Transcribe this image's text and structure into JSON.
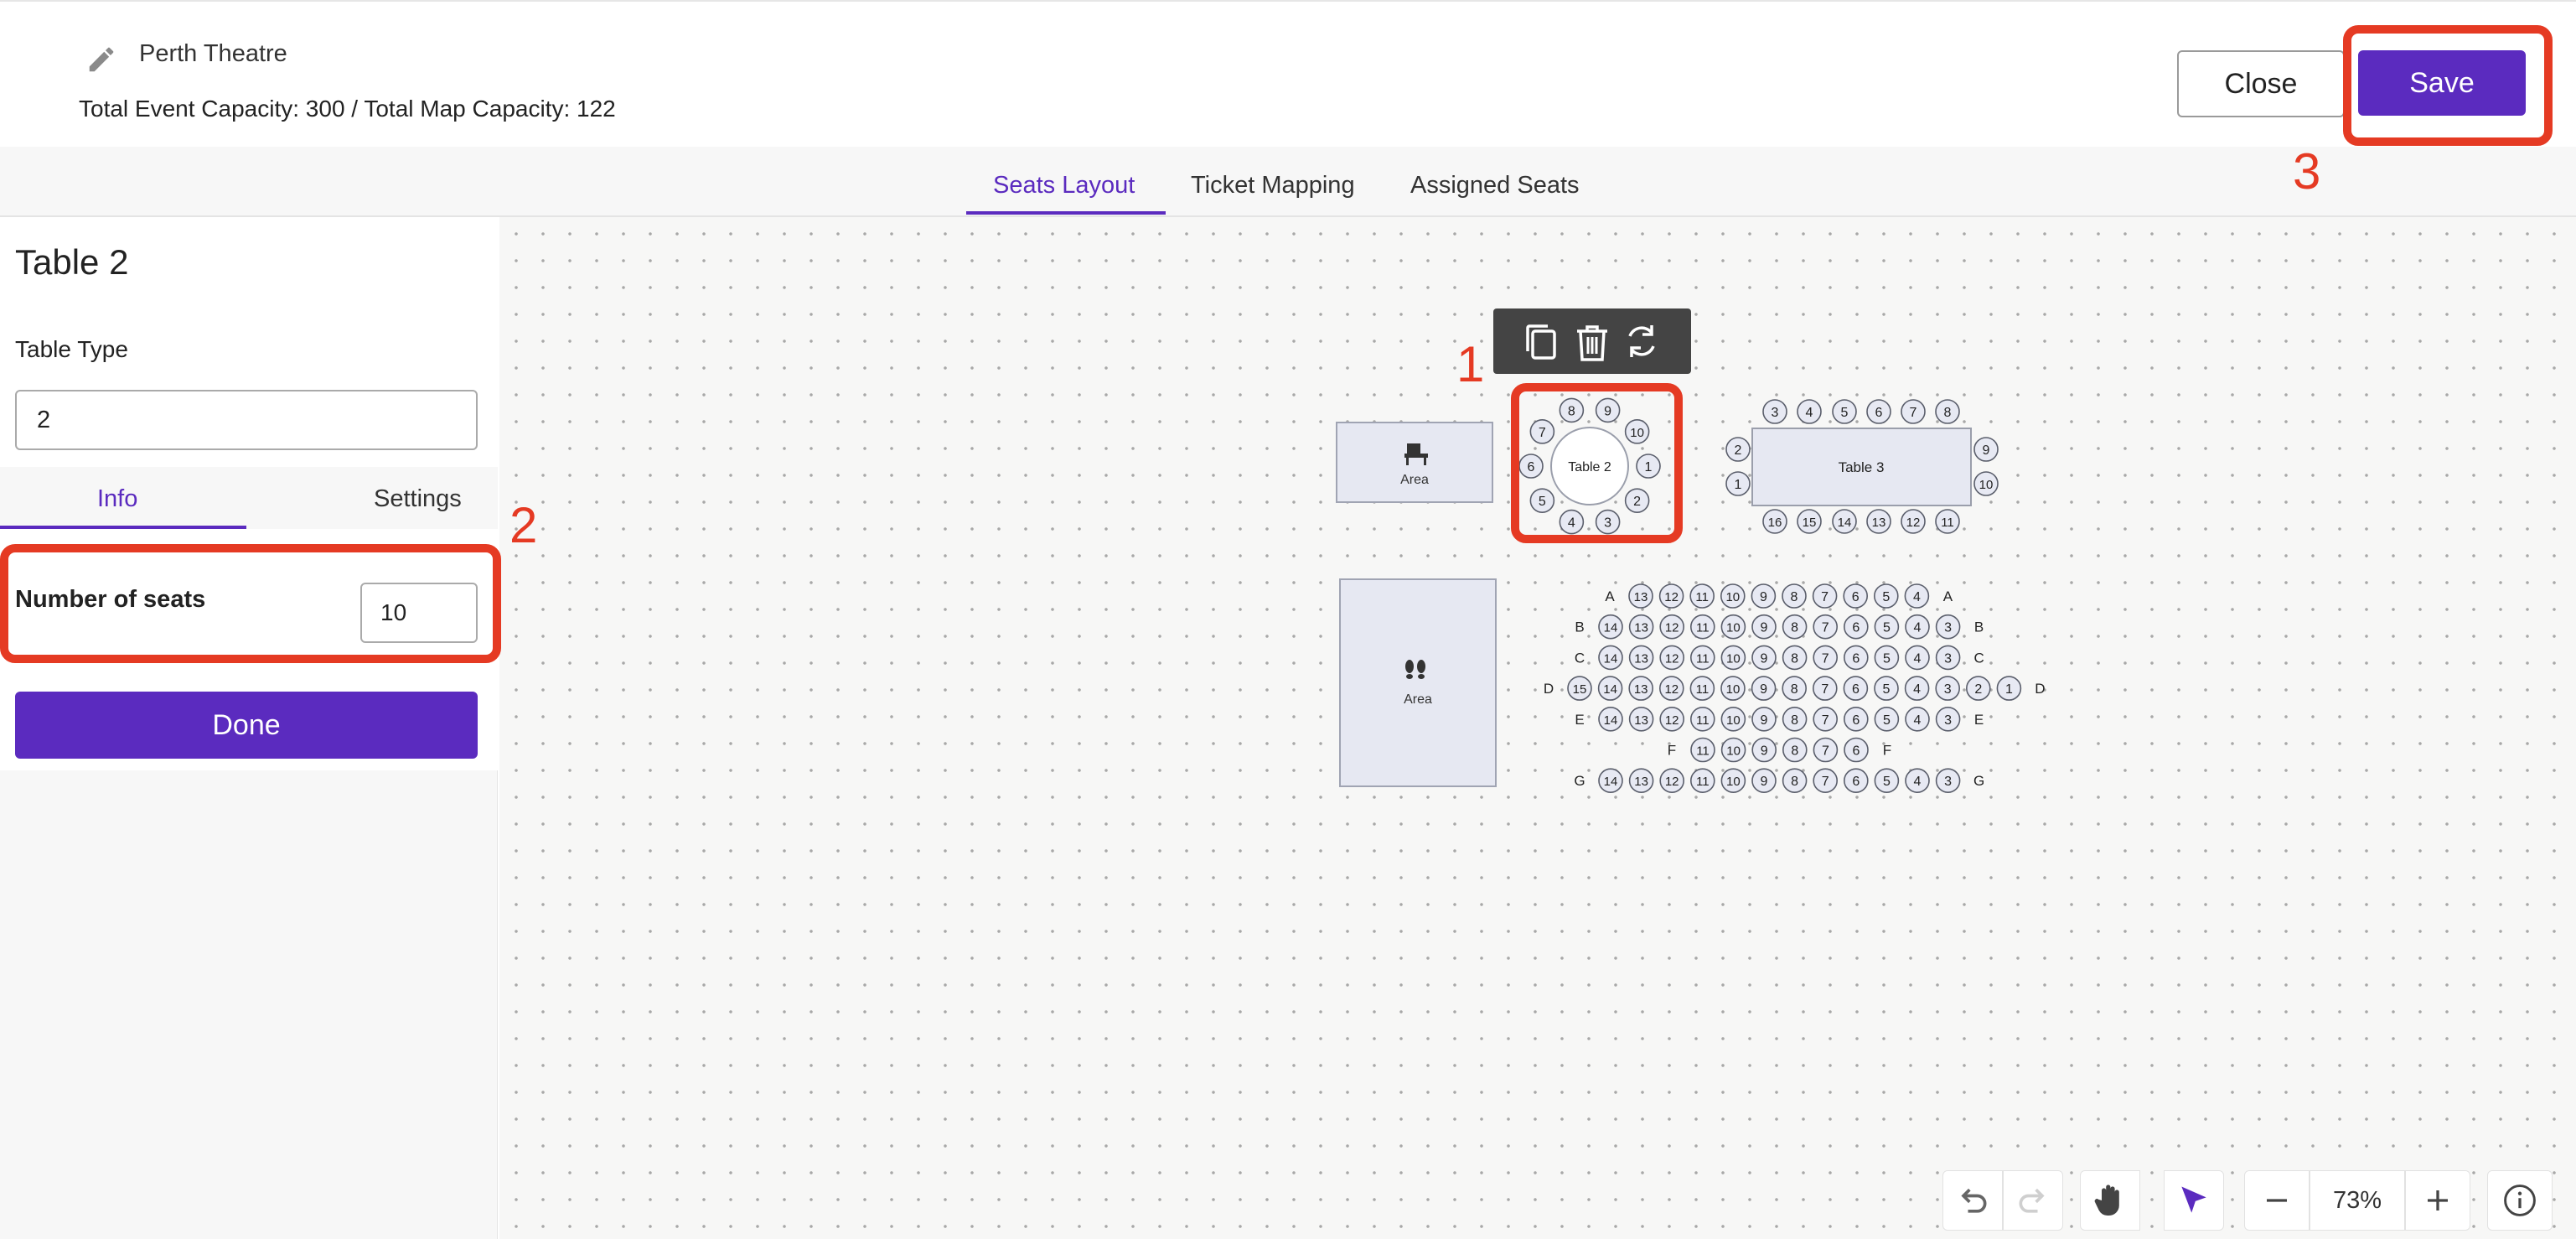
{
  "header": {
    "event_title": "Perth Theatre",
    "capacity_text": "Total Event Capacity: 300 / Total Map Capacity: 122",
    "close_label": "Close",
    "save_label": "Save"
  },
  "tabs": [
    {
      "label": "Seats Layout",
      "active": true
    },
    {
      "label": "Ticket Mapping",
      "active": false
    },
    {
      "label": "Assigned Seats",
      "active": false
    }
  ],
  "panel": {
    "title": "Table 2",
    "table_type_label": "Table Type",
    "table_type_value": "2",
    "subtabs": [
      {
        "label": "Info",
        "active": true
      },
      {
        "label": "Settings",
        "active": false
      }
    ],
    "seats_label": "Number of seats",
    "seats_value": "10",
    "done_label": "Done"
  },
  "canvas": {
    "areas": [
      {
        "label": "Area",
        "icon": "chair-icon"
      },
      {
        "label": "Area",
        "icon": "footprints-icon"
      }
    ],
    "table2": {
      "label": "Table 2",
      "seats": [
        "1",
        "2",
        "3",
        "4",
        "5",
        "6",
        "7",
        "8",
        "9",
        "10"
      ]
    },
    "table3": {
      "label": "Table 3",
      "top_seats": [
        "3",
        "4",
        "5",
        "6",
        "7",
        "8"
      ],
      "bottom_seats": [
        "16",
        "15",
        "14",
        "13",
        "12",
        "11"
      ],
      "left_seats": [
        "2",
        "1"
      ],
      "right_seats": [
        "9",
        "10"
      ]
    },
    "rows": [
      {
        "label": "A",
        "seats": [
          "13",
          "12",
          "11",
          "10",
          "9",
          "8",
          "7",
          "6",
          "5",
          "4"
        ]
      },
      {
        "label": "B",
        "seats": [
          "14",
          "13",
          "12",
          "11",
          "10",
          "9",
          "8",
          "7",
          "6",
          "5",
          "4",
          "3"
        ]
      },
      {
        "label": "C",
        "seats": [
          "14",
          "13",
          "12",
          "11",
          "10",
          "9",
          "8",
          "7",
          "6",
          "5",
          "4",
          "3"
        ]
      },
      {
        "label": "D",
        "seats": [
          "15",
          "14",
          "13",
          "12",
          "11",
          "10",
          "9",
          "8",
          "7",
          "6",
          "5",
          "4",
          "3",
          "2",
          "1"
        ]
      },
      {
        "label": "E",
        "seats": [
          "14",
          "13",
          "12",
          "11",
          "10",
          "9",
          "8",
          "7",
          "6",
          "5",
          "4",
          "3"
        ]
      },
      {
        "label": "F",
        "seats": [
          "11",
          "10",
          "9",
          "8",
          "7",
          "6"
        ]
      },
      {
        "label": "G",
        "seats": [
          "14",
          "13",
          "12",
          "11",
          "10",
          "9",
          "8",
          "7",
          "6",
          "5",
          "4",
          "3"
        ]
      }
    ],
    "selection_tools": [
      "copy-icon",
      "trash-icon",
      "rotate-icon"
    ]
  },
  "annotations": [
    "1",
    "2",
    "3"
  ],
  "toolbar": {
    "zoom": "73%",
    "tools": [
      "undo-icon",
      "redo-icon",
      "hand-icon",
      "pointer-icon",
      "zoom-out-icon",
      "zoom-in-icon",
      "info-icon"
    ]
  },
  "colors": {
    "accent": "#5b2bbf",
    "annotation": "#e53a23",
    "seat_fill": "#e7e9f3",
    "area_fill": "#e6e8f2"
  }
}
